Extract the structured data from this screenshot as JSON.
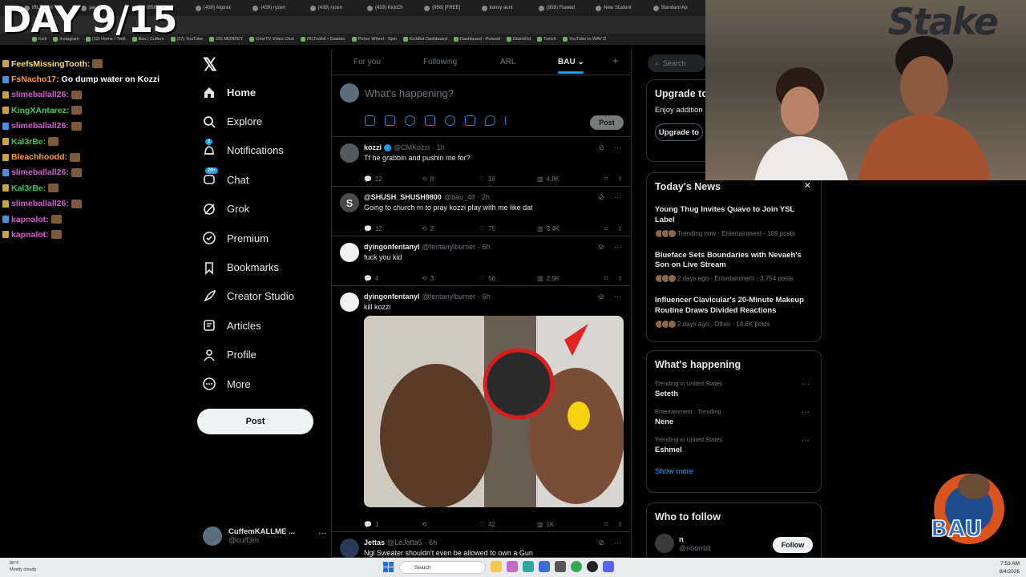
{
  "stream": {
    "day_title": "DAY 9/15",
    "chat": [
      {
        "user": "FeefsMissingTooth:",
        "msg": "",
        "color": "#ffe066",
        "emote": true
      },
      {
        "user": "FsNacho17:",
        "msg": "Go dump water on Kozzi",
        "color": "#ff9b2e",
        "emote": false
      },
      {
        "user": "slimeballall26:",
        "msg": "",
        "color": "#d35cd0",
        "emote": true
      },
      {
        "user": "KingXAntarez:",
        "msg": "",
        "color": "#3bd44a",
        "emote": true
      },
      {
        "user": "slimeballall26:",
        "msg": "",
        "color": "#d35cd0",
        "emote": true
      },
      {
        "user": "Kal3rBe:",
        "msg": "",
        "color": "#39c84f",
        "emote": true
      },
      {
        "user": "Bleachhoodd:",
        "msg": "",
        "color": "#ff9b2e",
        "emote": true
      },
      {
        "user": "slimeballall26:",
        "msg": "",
        "color": "#d35cd0",
        "emote": true
      },
      {
        "user": "Kal3rBe:",
        "msg": "",
        "color": "#39c84f",
        "emote": true
      },
      {
        "user": "slimeballall26:",
        "msg": "",
        "color": "#d35cd0",
        "emote": true
      },
      {
        "user": "kapnalot:",
        "msg": "",
        "color": "#d35cd0",
        "emote": true
      },
      {
        "user": "kapnalot:",
        "msg": "",
        "color": "#d35cd0",
        "emote": true
      }
    ]
  },
  "browser": {
    "tabs": [
      "IRLToolkit",
      "jae on",
      "(958) swimm",
      "(439) Algovic",
      "(439) ryzen",
      "(439) ryzen",
      "(439) KickCh",
      "(958) [FREE]",
      "konvy aunt",
      "(958) Flawed",
      "New Student",
      "Standard Ap"
    ],
    "bookmarks": [
      "Kick",
      "Instagram",
      "(12) Home / Twitt",
      "Bau | Cuffem",
      "(57) YouTube",
      "OG MONKEY",
      "OmeTV Video Chat",
      "IRLToolkit • Dashbo",
      "Picker Wheel - Spin",
      "KickBot Dashboard",
      "Dashboard - Pulsoid",
      "DistroKid",
      "Twitch",
      "YouTube to WAV D"
    ]
  },
  "nav": {
    "items": [
      {
        "label": "Home",
        "icon": "home-icon"
      },
      {
        "label": "Explore",
        "icon": "search-icon"
      },
      {
        "label": "Notifications",
        "icon": "bell-icon",
        "badge": "2"
      },
      {
        "label": "Chat",
        "icon": "chat-icon",
        "badge": "20+"
      },
      {
        "label": "Grok",
        "icon": "grok-icon"
      },
      {
        "label": "Premium",
        "icon": "premium-icon"
      },
      {
        "label": "Bookmarks",
        "icon": "bookmark-icon"
      },
      {
        "label": "Creator Studio",
        "icon": "rocket-icon"
      },
      {
        "label": "Articles",
        "icon": "article-icon"
      },
      {
        "label": "Profile",
        "icon": "person-icon"
      },
      {
        "label": "More",
        "icon": "more-circle-icon"
      }
    ],
    "post_label": "Post",
    "account": {
      "name": "CuffemKALLME ...",
      "handle": "@cuff3m"
    }
  },
  "feed": {
    "tabs": [
      "For you",
      "Following",
      "ARL",
      "BAU"
    ],
    "compose_placeholder": "What's happening?",
    "post_label": "Post",
    "tweets": [
      {
        "name": "kozzi",
        "verified": true,
        "handle": "@CMKozzi",
        "time": "· 1h",
        "text": "Tf he grabbin and pushin me for?",
        "replies": "22",
        "reposts": "8",
        "likes": "16",
        "views": "4.8K",
        "avatar": "#555a60"
      },
      {
        "name": "@SHUSH_SHUSH9800",
        "verified": false,
        "handle": "@bau_4lf",
        "time": "· 2h",
        "text": "Going to church rn to pray kozzi play with me like dat",
        "replies": "12",
        "reposts": "2",
        "likes": "75",
        "views": "3.4K",
        "avatar": "#4a4a4a",
        "avatar_letter": "S"
      },
      {
        "name": "dyingonfentanyl",
        "verified": false,
        "handle": "@fentanylburner",
        "time": "· 6h",
        "text": "fuck you kid",
        "replies": "4",
        "reposts": "3",
        "likes": "56",
        "views": "2.5K",
        "avatar": "#f0f0f0"
      },
      {
        "name": "dyingonfentanyl",
        "verified": false,
        "handle": "@fentanylburner",
        "time": "· 6h",
        "text": "kill kozzi",
        "replies": "1",
        "reposts": "",
        "likes": "42",
        "views": "1K",
        "avatar": "#f0f0f0",
        "media": true
      },
      {
        "name": "Jettas",
        "verified": false,
        "handle": "@LeJetta5",
        "time": "· 6h",
        "text": "Ngl Sweater shouldn't even be allowed to own a Gun",
        "avatar": "#2a3a5a"
      }
    ]
  },
  "sidebar": {
    "search_placeholder": "Search",
    "upgrade": {
      "title": "Upgrade to",
      "text": "Enjoy addition largest reply p",
      "button": "Upgrade to"
    },
    "news": {
      "title": "Today's News",
      "items": [
        {
          "title": "Young Thug Invites Quavo to Join YSL Label",
          "meta": "Trending now · Entertainment · 109 posts"
        },
        {
          "title": "Blueface Sets Boundaries with Nevaeh's Son on Live Stream",
          "meta": "2 days ago · Entertainment · 3,754 posts"
        },
        {
          "title": "Influencer Clavicular's 20-Minute Makeup Routine Draws Divided Reactions",
          "meta": "2 days ago · Other · 14.8K posts"
        }
      ]
    },
    "happening": {
      "title": "What's happening",
      "trends": [
        {
          "context": "Trending in United States",
          "name": "Seteth"
        },
        {
          "context": "Entertainment · Trending",
          "name": "Nene"
        },
        {
          "context": "Trending in United States",
          "name": "Eshmel"
        }
      ],
      "show_more": "Show more"
    },
    "follow": {
      "title": "Who to follow",
      "name": "n",
      "handle": "@noorrbit",
      "button": "Follow"
    }
  },
  "webcam": {
    "logo": "Stake"
  },
  "bau_logo": "BAU",
  "taskbar": {
    "weather_temp": "86°F",
    "weather_desc": "Mostly cloudy",
    "search": "Search",
    "time": "7:53 AM",
    "date": "8/4/2026"
  },
  "colors": {
    "accent": "#1d9bf0",
    "background": "#000000",
    "border": "#2f3336",
    "muted": "#71767b"
  }
}
